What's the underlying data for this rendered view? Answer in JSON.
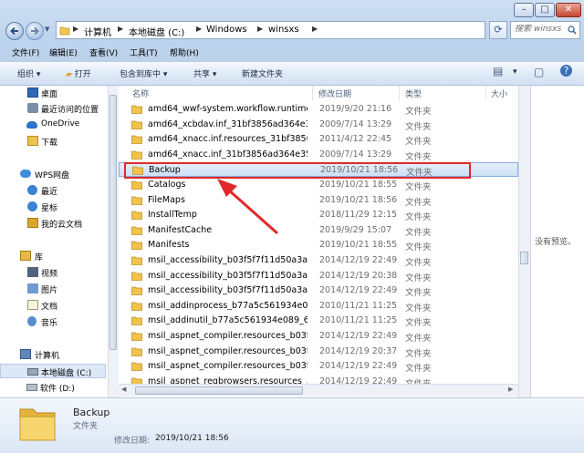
{
  "address": {
    "crumbs": [
      "计算机",
      "本地磁盘 (C:)",
      "Windows",
      "winsxs"
    ]
  },
  "search": {
    "placeholder": "搜索 winsxs"
  },
  "menu": [
    "文件(F)",
    "编辑(E)",
    "查看(V)",
    "工具(T)",
    "帮助(H)"
  ],
  "toolbar": {
    "organize": "组织",
    "open": "打开",
    "include": "包含到库中",
    "share": "共享",
    "new_folder": "新建文件夹"
  },
  "nav": {
    "items": [
      {
        "label": "桌面",
        "icon": "desktop-icon"
      },
      {
        "label": "最近访问的位置",
        "icon": "recent-places-icon"
      },
      {
        "label": "OneDrive",
        "icon": "onedrive-icon"
      },
      {
        "label": "下载",
        "icon": "download-folder-icon"
      },
      {
        "label": "WPS网盘",
        "icon": "wps-cloud-icon"
      },
      {
        "label": "最近",
        "icon": "clock-icon"
      },
      {
        "label": "星标",
        "icon": "star-icon"
      },
      {
        "label": "我的云文档",
        "icon": "cloud-doc-icon"
      },
      {
        "label": "库",
        "icon": "library-icon"
      },
      {
        "label": "视频",
        "icon": "video-library-icon"
      },
      {
        "label": "图片",
        "icon": "picture-library-icon"
      },
      {
        "label": "文档",
        "icon": "document-library-icon"
      },
      {
        "label": "音乐",
        "icon": "music-library-icon"
      },
      {
        "label": "计算机",
        "icon": "computer-icon"
      },
      {
        "label": "本地磁盘 (C:)",
        "icon": "local-disk-icon"
      },
      {
        "label": "软件 (D:)",
        "icon": "drive-icon"
      }
    ]
  },
  "columns": {
    "name": "名称",
    "modified": "修改日期",
    "type": "类型",
    "size": "大小"
  },
  "files": [
    {
      "name": "amd64_wwf-system.workflow.runtime...",
      "modified": "2019/9/20 21:16",
      "type": "文件夹"
    },
    {
      "name": "amd64_xcbdav.inf_31bf3856ad364e3...",
      "modified": "2009/7/14 13:29",
      "type": "文件夹"
    },
    {
      "name": "amd64_xnacc.inf.resources_31bf3856...",
      "modified": "2011/4/12 22:45",
      "type": "文件夹"
    },
    {
      "name": "amd64_xnacc.inf_31bf3856ad364e35_...",
      "modified": "2009/7/14 13:29",
      "type": "文件夹"
    },
    {
      "name": "Backup",
      "modified": "2019/10/21 18:56",
      "type": "文件夹",
      "selected": true
    },
    {
      "name": "Catalogs",
      "modified": "2019/10/21 18:55",
      "type": "文件夹"
    },
    {
      "name": "FileMaps",
      "modified": "2019/10/21 18:56",
      "type": "文件夹"
    },
    {
      "name": "InstallTemp",
      "modified": "2018/11/29 12:15",
      "type": "文件夹"
    },
    {
      "name": "ManifestCache",
      "modified": "2019/9/29 15:07",
      "type": "文件夹"
    },
    {
      "name": "Manifests",
      "modified": "2019/10/21 18:55",
      "type": "文件夹"
    },
    {
      "name": "msil_accessibility_b03f5f7f11d50a3a_...",
      "modified": "2014/12/19 22:49",
      "type": "文件夹"
    },
    {
      "name": "msil_accessibility_b03f5f7f11d50a3a_...",
      "modified": "2014/12/19 20:38",
      "type": "文件夹"
    },
    {
      "name": "msil_accessibility_b03f5f7f11d50a3a_...",
      "modified": "2014/12/19 22:49",
      "type": "文件夹"
    },
    {
      "name": "msil_addinprocess_b77a5c561934e08...",
      "modified": "2010/11/21 11:25",
      "type": "文件夹"
    },
    {
      "name": "msil_addinutil_b77a5c561934e089_6.1...",
      "modified": "2010/11/21 11:25",
      "type": "文件夹"
    },
    {
      "name": "msil_aspnet_compiler.resources_b03f...",
      "modified": "2014/12/19 22:49",
      "type": "文件夹"
    },
    {
      "name": "msil_aspnet_compiler.resources_b03f...",
      "modified": "2014/12/19 20:37",
      "type": "文件夹"
    },
    {
      "name": "msil_aspnet_compiler.resources_b03f...",
      "modified": "2014/12/19 22:49",
      "type": "文件夹"
    },
    {
      "name": "msil_aspnet_regbrowsers.resources_...",
      "modified": "2014/12/19 22:49",
      "type": "文件夹"
    }
  ],
  "preview": {
    "empty_text": "没有预览。"
  },
  "details": {
    "name": "Backup",
    "type": "文件夹",
    "modified_label": "修改日期:",
    "modified_value": "2019/10/21 18:56"
  },
  "colors": {
    "highlight": "#e0292a",
    "annotation_arrow": "#e0292a"
  }
}
